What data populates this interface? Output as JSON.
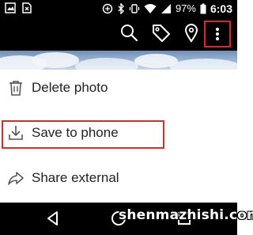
{
  "status_bar": {
    "battery_percent": "97%",
    "time": "6:03",
    "icons": [
      "image-icon",
      "sim-card-icon",
      "data-saver-icon",
      "bluetooth-icon",
      "vibrate-icon",
      "wifi-icon",
      "signal-icon",
      "battery-icon"
    ]
  },
  "action_bar": {
    "icons": [
      "search-icon",
      "tag-icon",
      "location-pin-icon",
      "more-vertical-icon"
    ],
    "highlight_color": "#e02424"
  },
  "menu": {
    "items": [
      {
        "label": "Delete photo",
        "icon": "trash-icon"
      },
      {
        "label": "Save to phone",
        "icon": "download-icon",
        "highlighted": true
      },
      {
        "label": "Share external",
        "icon": "share-arrow-icon"
      }
    ],
    "highlight_color": "#d32f2f"
  },
  "nav_bar": {
    "icons": [
      "back-icon",
      "home-icon",
      "recents-icon"
    ]
  },
  "watermark": {
    "text": "shenmazhishi.com"
  }
}
